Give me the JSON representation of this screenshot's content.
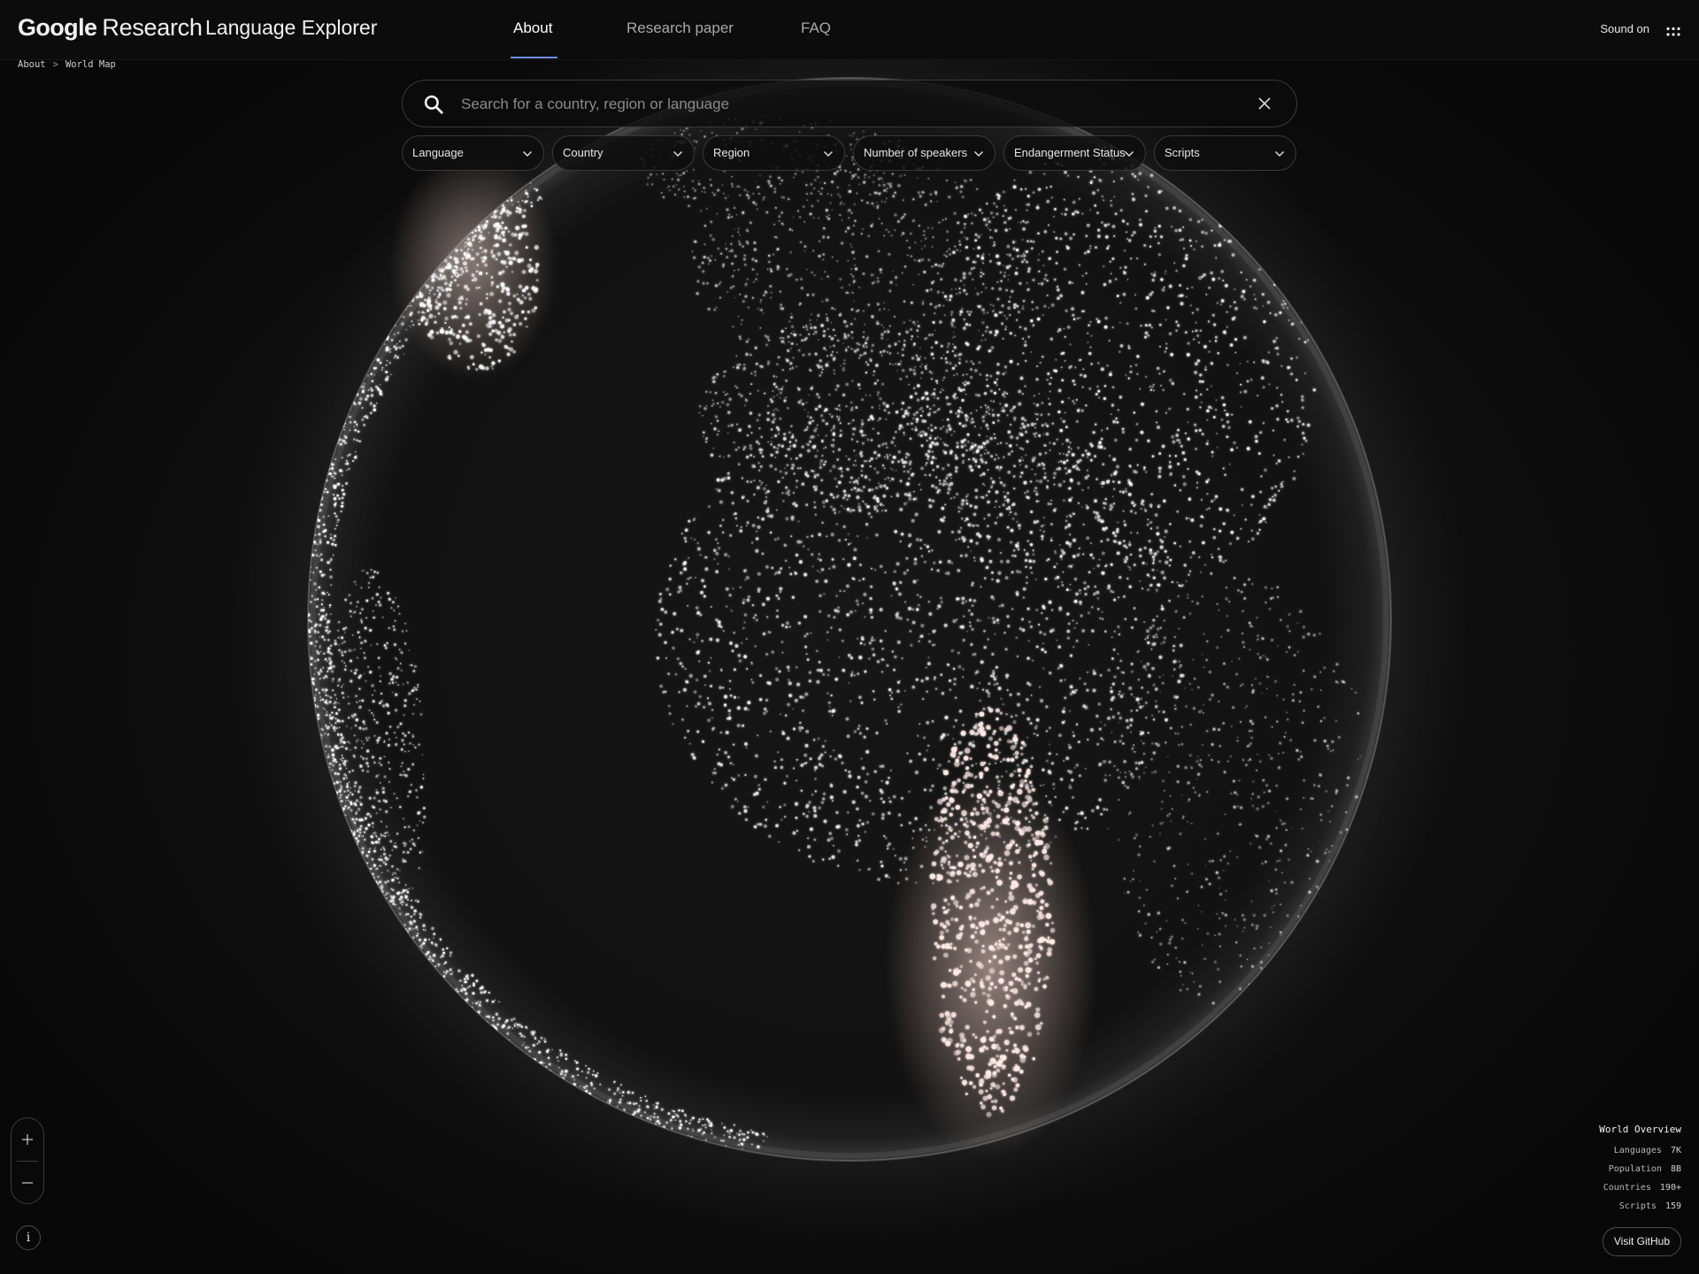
{
  "header": {
    "brand_google": "Google",
    "brand_research": "Research",
    "app_title": "Language Explorer",
    "tabs": [
      {
        "label": "About",
        "active": true
      },
      {
        "label": "Research paper",
        "active": false
      },
      {
        "label": "FAQ",
        "active": false
      }
    ],
    "sound_label": "Sound on",
    "apps_icon": "grid-dots-icon"
  },
  "breadcrumb": {
    "items": [
      "About",
      "World Map"
    ],
    "separator": ">"
  },
  "search": {
    "placeholder": "Search for a country, region or language",
    "value": "",
    "search_icon": "search-icon",
    "clear_icon": "close-icon"
  },
  "filters": [
    {
      "label": "Language"
    },
    {
      "label": "Country"
    },
    {
      "label": "Region"
    },
    {
      "label": "Number of speakers"
    },
    {
      "label": "Endangerment Status"
    },
    {
      "label": "Scripts"
    }
  ],
  "zoom": {
    "in_label": "+",
    "out_label": "−"
  },
  "info_label": "i",
  "overview": {
    "title": "World Overview",
    "rows": [
      {
        "label": "Languages",
        "value": "7K"
      },
      {
        "label": "Population",
        "value": "8B"
      },
      {
        "label": "Countries",
        "value": "190+"
      },
      {
        "label": "Scripts",
        "value": "159"
      }
    ]
  },
  "github_label": "Visit GitHub",
  "colors": {
    "background": "#0a0a0a",
    "accent_underline": "#6f8fe8",
    "dot": "#ffffff",
    "glow_warm": "#ffd9d2"
  }
}
